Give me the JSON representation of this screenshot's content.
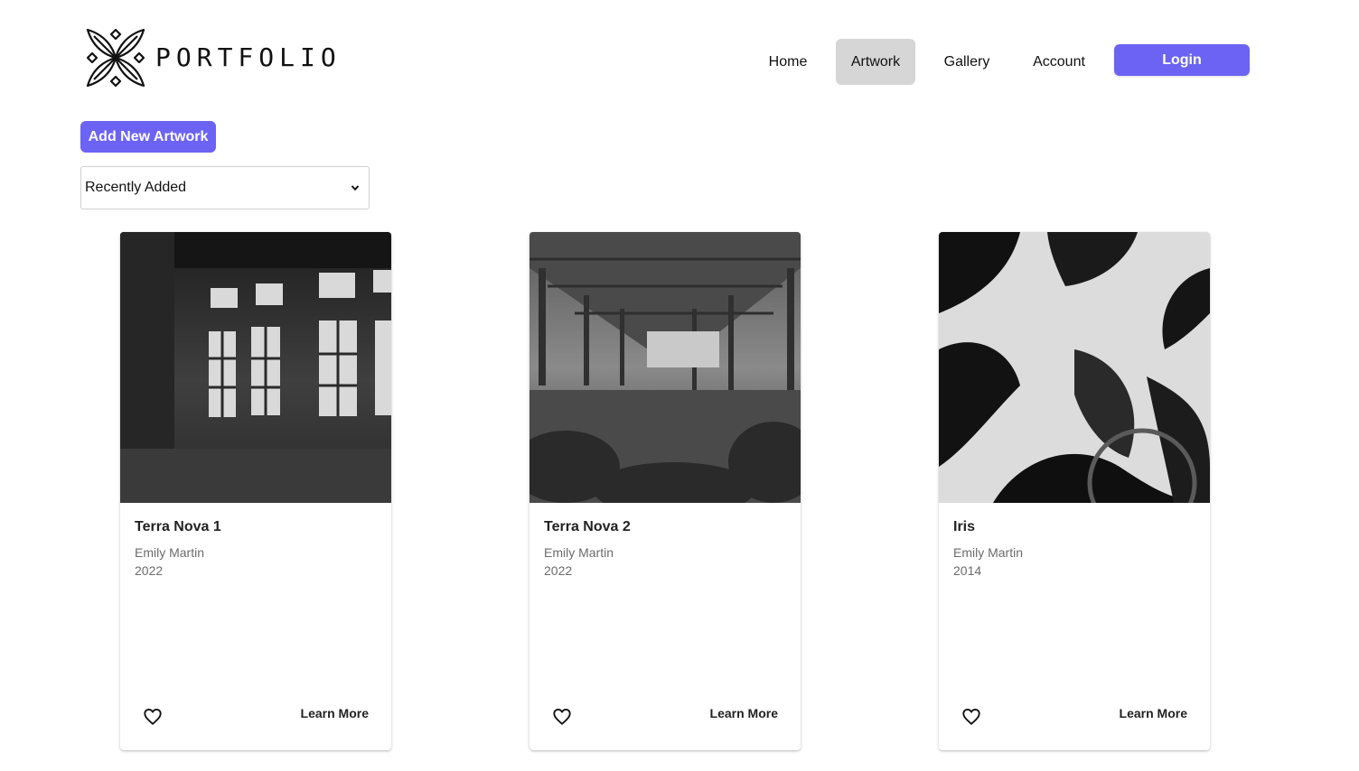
{
  "header": {
    "brand": "PORTFOLIO",
    "nav": [
      {
        "label": "Home",
        "active": false
      },
      {
        "label": "Artwork",
        "active": true
      },
      {
        "label": "Gallery",
        "active": false
      },
      {
        "label": "Account",
        "active": false
      }
    ],
    "login_label": "Login"
  },
  "toolbar": {
    "add_label": "Add New Artwork",
    "sort_selected": "Recently Added"
  },
  "artworks": [
    {
      "title": "Terra Nova 1",
      "artist": "Emily Martin",
      "year": "2022",
      "action": "Learn More",
      "image": "abandoned factory interior with windows (black and white)"
    },
    {
      "title": "Terra Nova 2",
      "artist": "Emily Martin",
      "year": "2022",
      "action": "Learn More",
      "image": "abandoned hall with columns and overgrowth (black and white)"
    },
    {
      "title": "Iris",
      "artist": "Emily Martin",
      "year": "2014",
      "action": "Learn More",
      "image": "abstract black and white iris petals"
    }
  ],
  "icons": {
    "logo": "floral-logo-icon",
    "favorite": "heart-icon",
    "dropdown": "chevron-down-icon"
  },
  "colors": {
    "accent": "#6c63f5",
    "active_nav": "#d6d6d6"
  }
}
